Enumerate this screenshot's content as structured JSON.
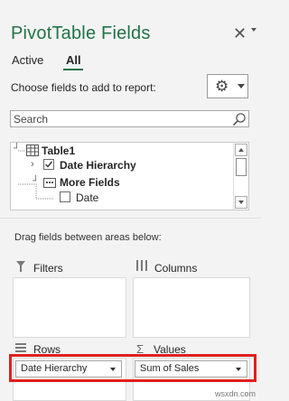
{
  "panel": {
    "title": "PivotTable Fields",
    "close_glyph": "✕",
    "tabs": [
      {
        "label": "Active",
        "selected": false
      },
      {
        "label": "All",
        "selected": true
      }
    ],
    "choose_label": "Choose fields to add to report:",
    "tools_icon": "gear-icon"
  },
  "search": {
    "placeholder": "Search",
    "value": ""
  },
  "tree": {
    "table_name": "Table1",
    "items": [
      {
        "label": "Date Hierarchy",
        "checked": true,
        "expand": "chevron-right-icon"
      },
      {
        "label": "More Fields",
        "expand": "collapse-icon"
      },
      {
        "label": "Date",
        "checked": false
      }
    ]
  },
  "areas": {
    "hint": "Drag fields between areas below:",
    "filters_label": "Filters",
    "columns_label": "Columns",
    "rows_label": "Rows",
    "values_label": "Values",
    "rows_field": "Date Hierarchy",
    "values_field": "Sum of Sales"
  },
  "watermark": "wsxdn.com",
  "colors": {
    "accent": "#217346",
    "highlight": "#e02020"
  }
}
